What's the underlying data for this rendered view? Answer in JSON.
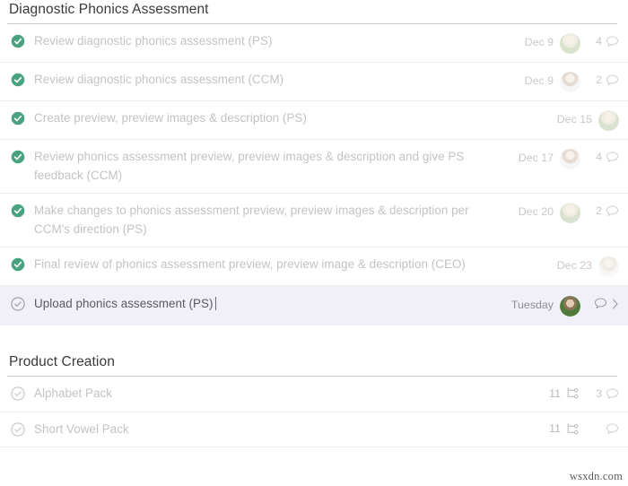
{
  "sections": [
    {
      "title": "Diagnostic Phonics Assessment",
      "tasks": [
        {
          "label": "Review diagnostic phonics assessment (PS)",
          "state": "done",
          "due": "Dec 9",
          "avatar": "avatar-green-blonde",
          "comment_count": "4",
          "has_comment_icon": true,
          "active": false
        },
        {
          "label": "Review diagnostic phonics assessment (CCM)",
          "state": "done",
          "due": "Dec 9",
          "avatar": "avatar-light-brunette",
          "comment_count": "2",
          "has_comment_icon": true,
          "active": false
        },
        {
          "label": "Create preview, preview images & description (PS)",
          "state": "done",
          "due": "Dec 15",
          "avatar": "avatar-green-blonde",
          "comment_count": "",
          "has_comment_icon": false,
          "active": false
        },
        {
          "label": "Review phonics assessment preview, preview images & description and give PS feedback (CCM)",
          "state": "done",
          "due": "Dec 17",
          "avatar": "avatar-light-brunette",
          "comment_count": "4",
          "has_comment_icon": true,
          "active": false
        },
        {
          "label": "Make changes to phonics assessment preview, preview images & description per CCM's direction (PS)",
          "state": "done",
          "due": "Dec 20",
          "avatar": "avatar-green-blonde",
          "comment_count": "2",
          "has_comment_icon": true,
          "active": false
        },
        {
          "label": "Final review of phonics assessment preview, preview image & description (CEO)",
          "state": "done",
          "due": "Dec 23",
          "avatar": "avatar-pale-blonde",
          "comment_count": "",
          "has_comment_icon": false,
          "active": false
        },
        {
          "label": "Upload phonics assessment (PS)",
          "state": "open",
          "due": "Tuesday",
          "avatar": "avatar-dark-green",
          "comment_count": "",
          "has_comment_icon": true,
          "has_chevron": true,
          "active": true
        }
      ]
    },
    {
      "title": "Product Creation",
      "tasks": [
        {
          "label": "Alphabet Pack",
          "state": "open",
          "subtask_count": "11",
          "comment_count": "3",
          "has_comment_icon": true,
          "active": false
        },
        {
          "label": "Short Vowel Pack",
          "state": "open",
          "subtask_count": "11",
          "comment_count": "",
          "has_comment_icon": true,
          "active": false
        }
      ]
    }
  ],
  "icons": {
    "check_done": "check-circle-filled-icon",
    "check_open": "check-circle-outline-icon",
    "comment": "comment-bubble-icon",
    "chevron": "chevron-right-icon",
    "subtask": "subtask-branch-icon"
  },
  "colors": {
    "done_green": "#4aa280",
    "muted_text": "#c3c3c3",
    "active_bg": "#f1f0f8",
    "active_text": "#5a5a66",
    "rule": "#eeeeee",
    "header_rule": "#c9c9c9"
  },
  "watermark": "wsxdn.com"
}
